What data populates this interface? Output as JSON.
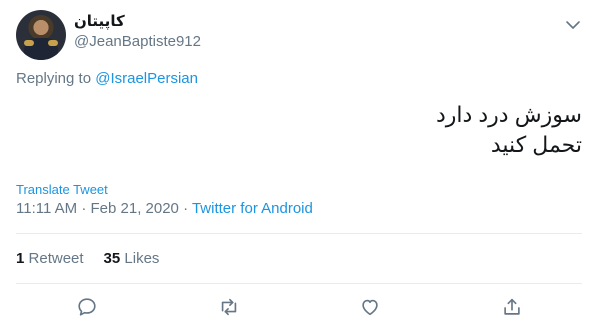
{
  "user": {
    "display_name": "کاپیتان",
    "handle": "@JeanBaptiste912"
  },
  "reply": {
    "prefix": "Replying to ",
    "to": "@IsraelPersian"
  },
  "tweet": {
    "text": "سوزش درد دارد\nتحمل کنید"
  },
  "translate_label": "Translate Tweet",
  "meta": {
    "time": "11:11 AM",
    "sep1": " · ",
    "date": "Feb 21, 2020",
    "sep2": " · ",
    "source": "Twitter for Android"
  },
  "stats": {
    "retweets_count": "1",
    "retweets_label": "Retweet",
    "likes_count": "35",
    "likes_label": "Likes"
  },
  "icons": {
    "caret": "chevron-down-icon",
    "reply": "reply-icon",
    "retweet": "retweet-icon",
    "like": "heart-icon",
    "share": "share-icon"
  },
  "colors": {
    "link": "#1b95e0",
    "muted": "#657786",
    "text": "#14171a",
    "divider": "#e6ecf0"
  }
}
